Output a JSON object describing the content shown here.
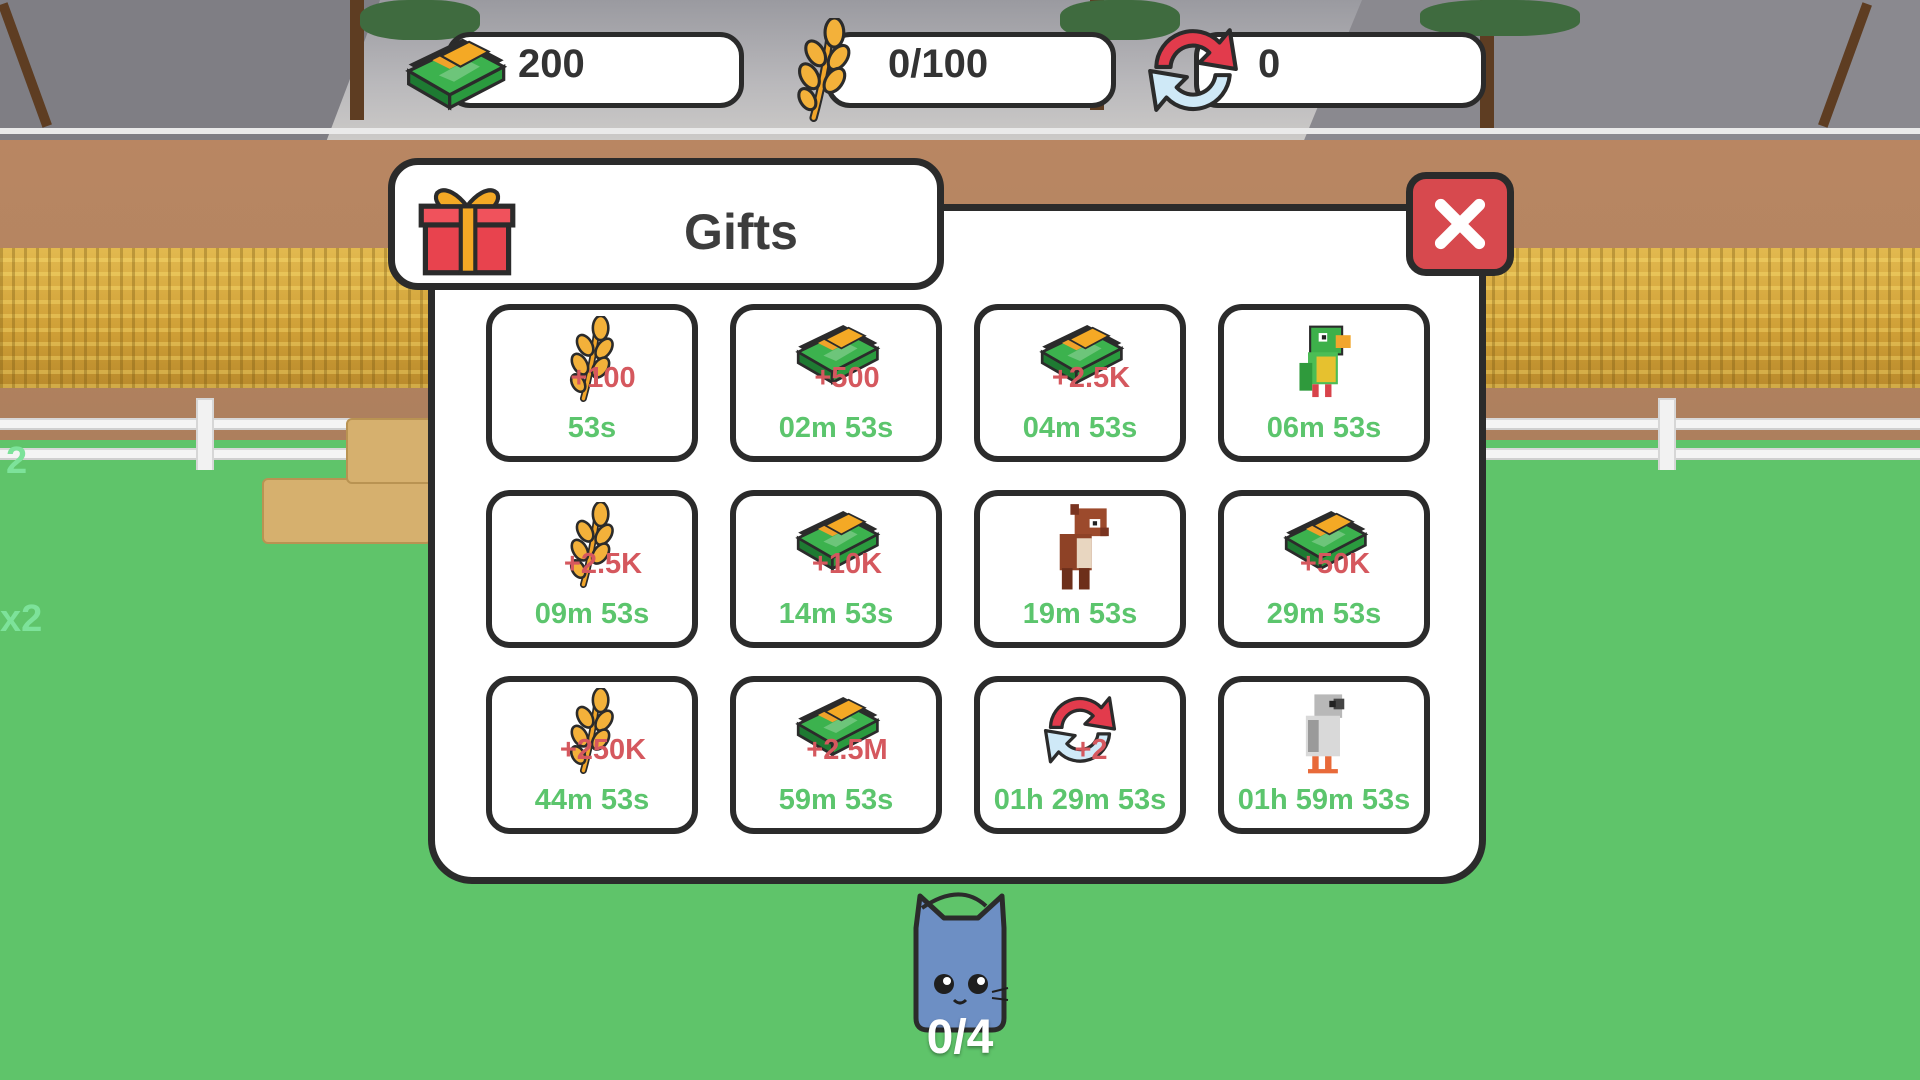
{
  "hud": {
    "cash": {
      "icon": "cash-icon",
      "value": "200"
    },
    "wheat": {
      "icon": "wheat-icon",
      "value": "0/100"
    },
    "rebirth": {
      "icon": "rebirth-icon",
      "value": "0"
    }
  },
  "gifts_panel": {
    "title": "Gifts",
    "title_icon": "gift-box-icon",
    "close_icon": "close-icon",
    "items": [
      {
        "icon": "wheat-icon",
        "amount": "+100",
        "timer": "53s"
      },
      {
        "icon": "cash-icon",
        "amount": "+500",
        "timer": "02m 53s"
      },
      {
        "icon": "cash-icon",
        "amount": "+2.5K",
        "timer": "04m 53s"
      },
      {
        "icon": "parrot-pet-icon",
        "amount": "",
        "timer": "06m 53s"
      },
      {
        "icon": "wheat-icon",
        "amount": "+2.5K",
        "timer": "09m 53s"
      },
      {
        "icon": "cash-icon",
        "amount": "+10K",
        "timer": "14m 53s"
      },
      {
        "icon": "horse-pet-icon",
        "amount": "",
        "timer": "19m 53s"
      },
      {
        "icon": "cash-icon",
        "amount": "+50K",
        "timer": "29m 53s"
      },
      {
        "icon": "wheat-icon",
        "amount": "+250K",
        "timer": "44m 53s"
      },
      {
        "icon": "cash-icon",
        "amount": "+2.5M",
        "timer": "59m 53s"
      },
      {
        "icon": "rebirth-icon",
        "amount": "+2",
        "timer": "01h 29m 53s"
      },
      {
        "icon": "pigeon-pet-icon",
        "amount": "",
        "timer": "01h 59m 53s"
      }
    ]
  },
  "side_labels": {
    "left_top": "2",
    "left_mid": "x2"
  },
  "pet_capacity": {
    "icon": "cat-pet-icon",
    "value": "0/4"
  },
  "colors": {
    "amount_text": "#d5585e",
    "timer_text": "#5cc56d",
    "close_button": "#d7494e",
    "outline": "#2b2b2b",
    "grass": "#5fc46a"
  }
}
